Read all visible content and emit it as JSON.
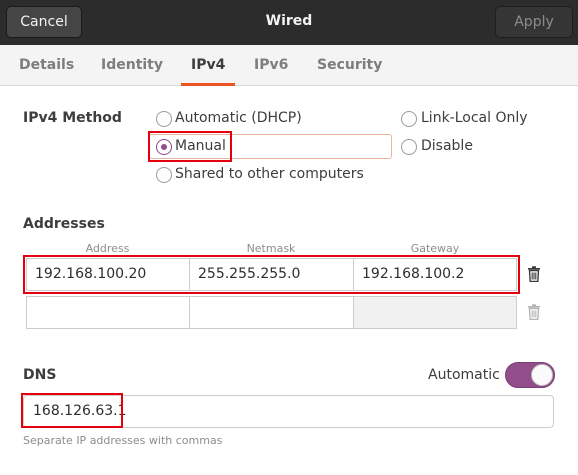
{
  "header": {
    "cancel_label": "Cancel",
    "title": "Wired",
    "apply_label": "Apply"
  },
  "tabs": [
    {
      "label": "Details",
      "active": false
    },
    {
      "label": "Identity",
      "active": false
    },
    {
      "label": "IPv4",
      "active": true
    },
    {
      "label": "IPv6",
      "active": false
    },
    {
      "label": "Security",
      "active": false
    }
  ],
  "ipv4_method": {
    "label": "IPv4 Method",
    "selected": "Manual",
    "options": [
      {
        "label": "Automatic (DHCP)",
        "checked": false
      },
      {
        "label": "Link-Local Only",
        "checked": false
      },
      {
        "label": "Manual",
        "checked": true
      },
      {
        "label": "Disable",
        "checked": false
      },
      {
        "label": "Shared to other computers",
        "checked": false
      }
    ]
  },
  "addresses": {
    "label": "Addresses",
    "columns": [
      "Address",
      "Netmask",
      "Gateway"
    ],
    "rows": [
      [
        "192.168.100.20",
        "255.255.255.0",
        "192.168.100.2"
      ],
      [
        "",
        "",
        ""
      ]
    ]
  },
  "dns": {
    "label": "DNS",
    "automatic_label": "Automatic",
    "automatic_on": true,
    "value": "168.126.63.1",
    "hint": "Separate IP addresses with commas"
  },
  "icons": {
    "trash": "trash-icon"
  },
  "colors": {
    "accent_tab": "#e95420",
    "accent_toggle": "#924d8b",
    "highlight": "#e4000f",
    "header_bg": "#2c2c2c"
  }
}
